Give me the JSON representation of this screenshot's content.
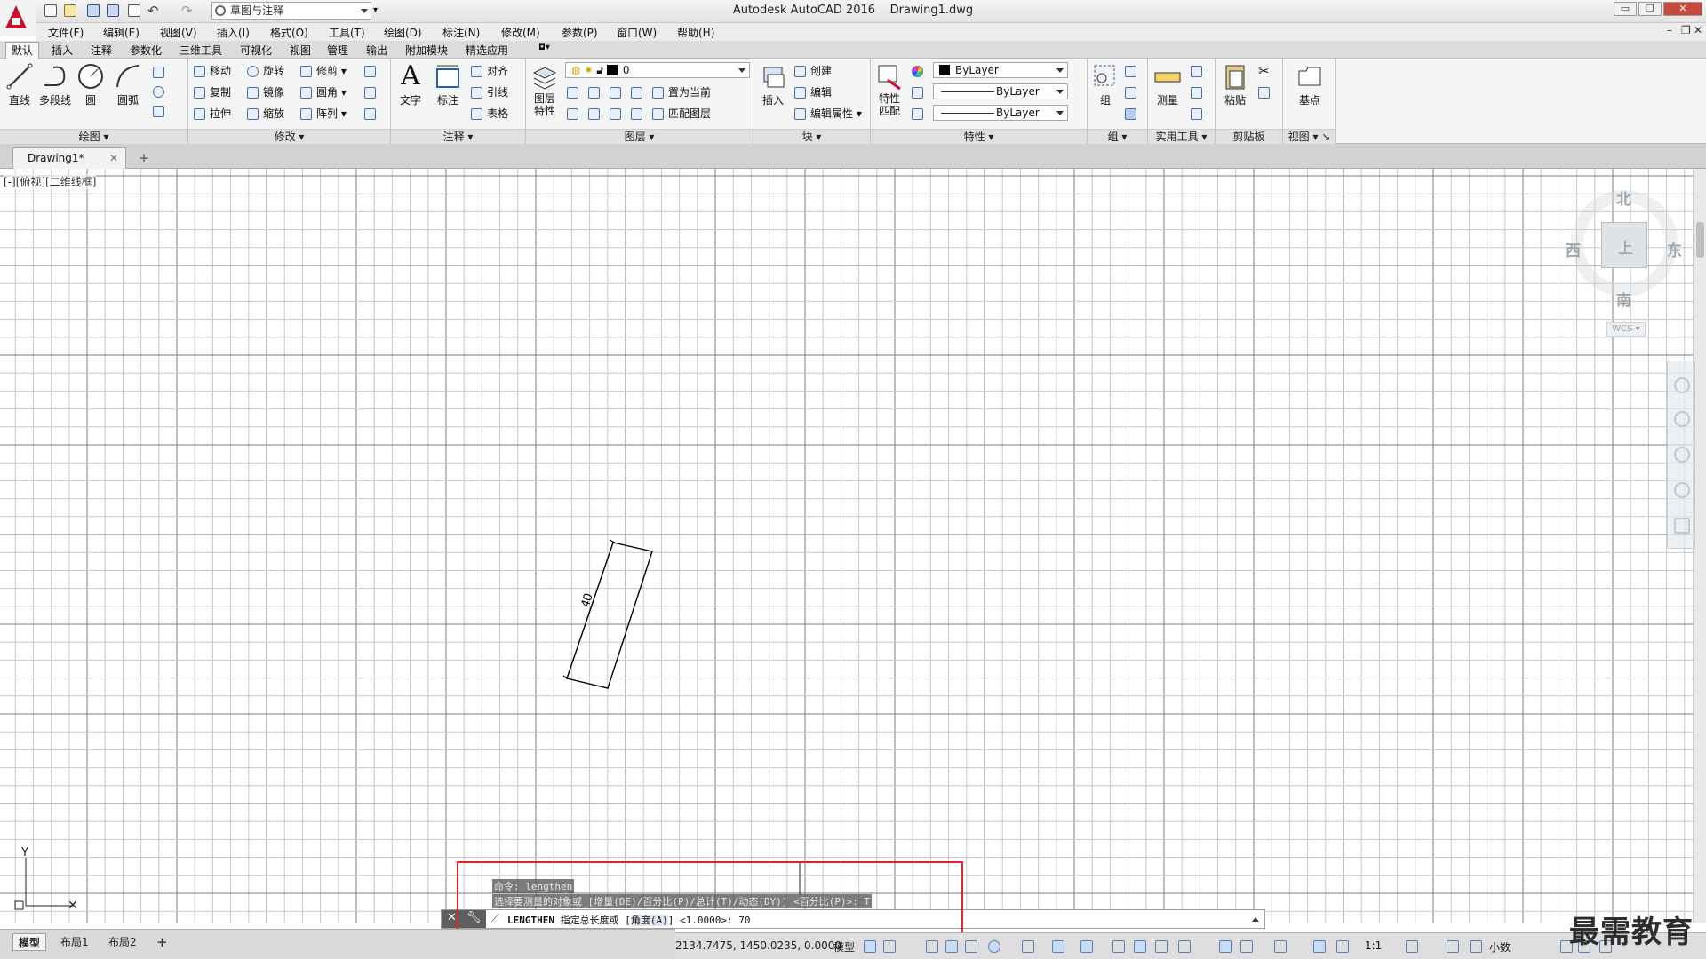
{
  "app": {
    "title": "Autodesk AutoCAD 2016    Drawing1.dwg",
    "workspace": "草图与注释"
  },
  "menu": [
    "文件(F)",
    "编辑(E)",
    "视图(V)",
    "插入(I)",
    "格式(O)",
    "工具(T)",
    "绘图(D)",
    "标注(N)",
    "修改(M)",
    "参数(P)",
    "窗口(W)",
    "帮助(H)"
  ],
  "ribbon_tabs": [
    "默认",
    "插入",
    "注释",
    "参数化",
    "三维工具",
    "可视化",
    "视图",
    "管理",
    "输出",
    "附加模块",
    "精选应用"
  ],
  "panels": {
    "draw": {
      "title": "绘图",
      "tools": [
        "直线",
        "多段线",
        "圆",
        "圆弧"
      ]
    },
    "modify": {
      "title": "修改",
      "tools": [
        "移动",
        "旋转",
        "修剪",
        "复制",
        "镜像",
        "圆角",
        "拉伸",
        "缩放",
        "阵列"
      ]
    },
    "annotation": {
      "title": "注释",
      "big": [
        "文字",
        "标注"
      ],
      "small": [
        "对齐",
        "引线",
        "表格"
      ]
    },
    "layers": {
      "title": "图层",
      "big": "图层\n特性",
      "current_layer": "0",
      "small": [
        "置为当前",
        "匹配图层"
      ]
    },
    "block": {
      "title": "块",
      "big": "插入",
      "small": [
        "创建",
        "编辑",
        "编辑属性"
      ]
    },
    "properties": {
      "title": "特性",
      "big": "特性\n匹配",
      "color": "ByLayer",
      "linetype": "ByLayer",
      "lineweight": "ByLayer"
    },
    "groups": {
      "title": "组",
      "big": "组"
    },
    "utilities": {
      "title": "实用工具",
      "big": "测量"
    },
    "clipboard": {
      "title": "剪贴板",
      "big": "粘贴"
    },
    "view": {
      "title": "视图",
      "big": "基点"
    }
  },
  "doc_tab": {
    "label": "Drawing1*"
  },
  "viewport_label": "[-][俯视][二维线框]",
  "viewcube": {
    "north": "北",
    "south": "南",
    "east": "东",
    "west": "西",
    "face": "上",
    "wcs": "WCS"
  },
  "drawing": {
    "dimension_value": "40",
    "accent_color": "#000000"
  },
  "command": {
    "history": [
      "命令:  lengthen",
      "选择要测量的对象或 [增量(DE)/百分比(P)/总计(T)/动态(DY)] <百分比(P)>: T"
    ],
    "keyword": "LENGTHEN",
    "prompt": "指定总长度或 [",
    "option": "角度(A)",
    "prompt_tail": "] <1.0000>:  70"
  },
  "layouts": [
    "模型",
    "布局1",
    "布局2"
  ],
  "status": {
    "coords": "2134.7475, 1450.0235, 0.0000",
    "model": "模型",
    "scale": "1:1",
    "units": "小数"
  },
  "watermark": "最需教育",
  "colors": {
    "highlight": "#e0262b",
    "logo": "#c8102e"
  }
}
